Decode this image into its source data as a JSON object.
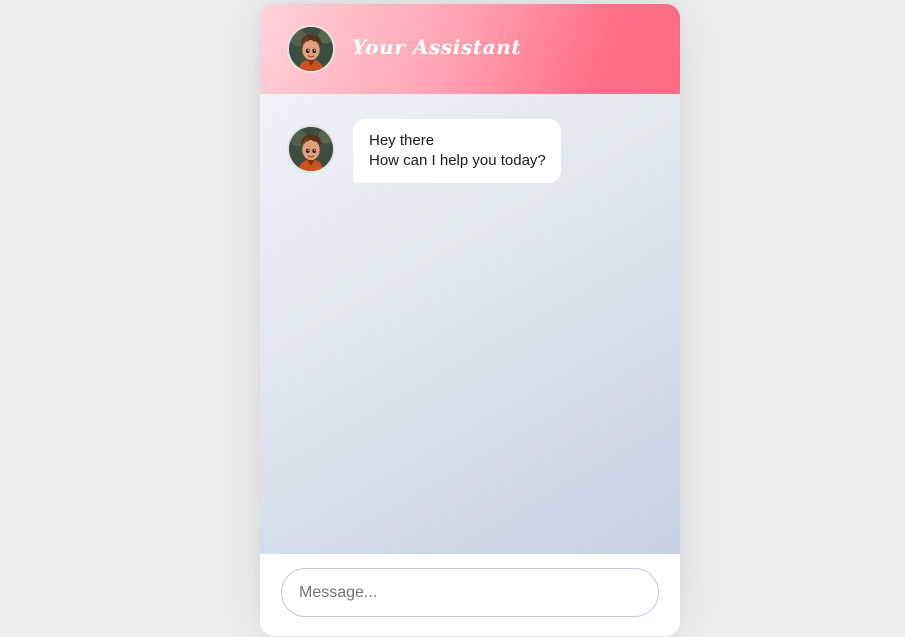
{
  "header": {
    "title": "Your Assistant",
    "avatar_icon": "assistant-avatar-icon"
  },
  "messages": [
    {
      "sender": "assistant",
      "avatar_icon": "assistant-avatar-icon",
      "lines": [
        "Hey there",
        "How can I help you today?"
      ]
    }
  ],
  "composer": {
    "value": "",
    "placeholder": "Message..."
  },
  "colors": {
    "page_background": "#efefef",
    "header_gradient_start": "#ffd3da",
    "header_gradient_end": "#ff6b84",
    "body_gradient_start": "#eff2f8",
    "body_gradient_end": "#c5d0e2",
    "bubble": "#ffffff",
    "input_border": "#c8c8e6"
  }
}
